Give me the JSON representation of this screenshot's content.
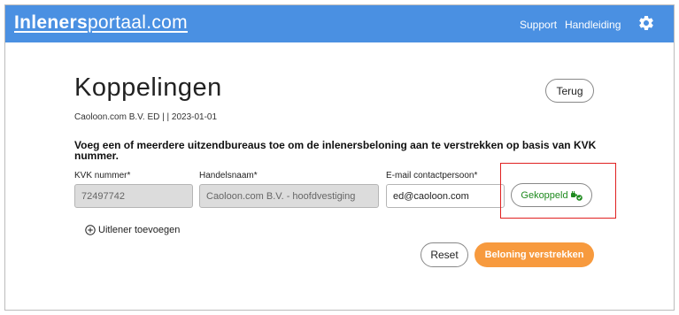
{
  "header": {
    "logo_bold": "Inleners",
    "logo_rest": "portaal.com",
    "links": [
      "Support",
      "Handleiding"
    ],
    "settings_icon": "gear-icon",
    "bg_color": "#4a90e2"
  },
  "page": {
    "title": "Koppelingen",
    "subtitle": "Caoloon.com B.V. ED | | 2023-01-01",
    "back_button": "Terug",
    "instruction": "Voeg een of meerdere uitzendbureaus toe om de inlenersbeloning aan te verstrekken op basis van KVK nummer."
  },
  "form": {
    "kvk_label": "KVK nummer*",
    "kvk_value": "72497742",
    "handelsnaam_label": "Handelsnaam*",
    "handelsnaam_value": "Caoloon.com B.V. - hoofdvestiging",
    "email_label": "E-mail contactpersoon*",
    "email_value": "ed@caoloon.com",
    "status_button": "Gekoppeld",
    "status_icon": "plug-connected-icon",
    "status_color": "#1e8a1e",
    "add_label": "Uitlener toevoegen",
    "add_icon": "plus-circle-icon"
  },
  "actions": {
    "reset": "Reset",
    "submit": "Beloning verstrekken",
    "submit_color": "#f79a3e"
  }
}
